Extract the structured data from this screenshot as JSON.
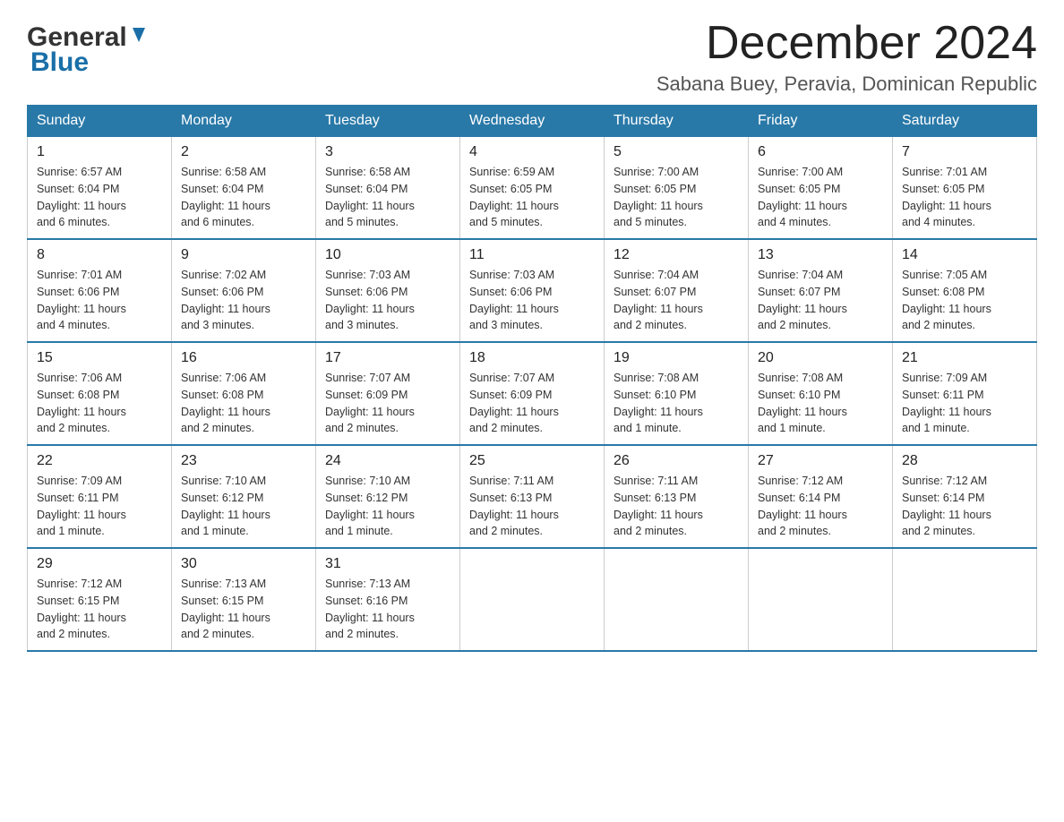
{
  "logo": {
    "general": "General",
    "blue": "Blue",
    "arrowColor": "#1a6fa8"
  },
  "header": {
    "month_year": "December 2024",
    "location": "Sabana Buey, Peravia, Dominican Republic"
  },
  "weekdays": [
    "Sunday",
    "Monday",
    "Tuesday",
    "Wednesday",
    "Thursday",
    "Friday",
    "Saturday"
  ],
  "weeks": [
    [
      {
        "day": "1",
        "sunrise": "6:57 AM",
        "sunset": "6:04 PM",
        "daylight": "11 hours and 6 minutes."
      },
      {
        "day": "2",
        "sunrise": "6:58 AM",
        "sunset": "6:04 PM",
        "daylight": "11 hours and 6 minutes."
      },
      {
        "day": "3",
        "sunrise": "6:58 AM",
        "sunset": "6:04 PM",
        "daylight": "11 hours and 5 minutes."
      },
      {
        "day": "4",
        "sunrise": "6:59 AM",
        "sunset": "6:05 PM",
        "daylight": "11 hours and 5 minutes."
      },
      {
        "day": "5",
        "sunrise": "7:00 AM",
        "sunset": "6:05 PM",
        "daylight": "11 hours and 5 minutes."
      },
      {
        "day": "6",
        "sunrise": "7:00 AM",
        "sunset": "6:05 PM",
        "daylight": "11 hours and 4 minutes."
      },
      {
        "day": "7",
        "sunrise": "7:01 AM",
        "sunset": "6:05 PM",
        "daylight": "11 hours and 4 minutes."
      }
    ],
    [
      {
        "day": "8",
        "sunrise": "7:01 AM",
        "sunset": "6:06 PM",
        "daylight": "11 hours and 4 minutes."
      },
      {
        "day": "9",
        "sunrise": "7:02 AM",
        "sunset": "6:06 PM",
        "daylight": "11 hours and 3 minutes."
      },
      {
        "day": "10",
        "sunrise": "7:03 AM",
        "sunset": "6:06 PM",
        "daylight": "11 hours and 3 minutes."
      },
      {
        "day": "11",
        "sunrise": "7:03 AM",
        "sunset": "6:06 PM",
        "daylight": "11 hours and 3 minutes."
      },
      {
        "day": "12",
        "sunrise": "7:04 AM",
        "sunset": "6:07 PM",
        "daylight": "11 hours and 2 minutes."
      },
      {
        "day": "13",
        "sunrise": "7:04 AM",
        "sunset": "6:07 PM",
        "daylight": "11 hours and 2 minutes."
      },
      {
        "day": "14",
        "sunrise": "7:05 AM",
        "sunset": "6:08 PM",
        "daylight": "11 hours and 2 minutes."
      }
    ],
    [
      {
        "day": "15",
        "sunrise": "7:06 AM",
        "sunset": "6:08 PM",
        "daylight": "11 hours and 2 minutes."
      },
      {
        "day": "16",
        "sunrise": "7:06 AM",
        "sunset": "6:08 PM",
        "daylight": "11 hours and 2 minutes."
      },
      {
        "day": "17",
        "sunrise": "7:07 AM",
        "sunset": "6:09 PM",
        "daylight": "11 hours and 2 minutes."
      },
      {
        "day": "18",
        "sunrise": "7:07 AM",
        "sunset": "6:09 PM",
        "daylight": "11 hours and 2 minutes."
      },
      {
        "day": "19",
        "sunrise": "7:08 AM",
        "sunset": "6:10 PM",
        "daylight": "11 hours and 1 minute."
      },
      {
        "day": "20",
        "sunrise": "7:08 AM",
        "sunset": "6:10 PM",
        "daylight": "11 hours and 1 minute."
      },
      {
        "day": "21",
        "sunrise": "7:09 AM",
        "sunset": "6:11 PM",
        "daylight": "11 hours and 1 minute."
      }
    ],
    [
      {
        "day": "22",
        "sunrise": "7:09 AM",
        "sunset": "6:11 PM",
        "daylight": "11 hours and 1 minute."
      },
      {
        "day": "23",
        "sunrise": "7:10 AM",
        "sunset": "6:12 PM",
        "daylight": "11 hours and 1 minute."
      },
      {
        "day": "24",
        "sunrise": "7:10 AM",
        "sunset": "6:12 PM",
        "daylight": "11 hours and 1 minute."
      },
      {
        "day": "25",
        "sunrise": "7:11 AM",
        "sunset": "6:13 PM",
        "daylight": "11 hours and 2 minutes."
      },
      {
        "day": "26",
        "sunrise": "7:11 AM",
        "sunset": "6:13 PM",
        "daylight": "11 hours and 2 minutes."
      },
      {
        "day": "27",
        "sunrise": "7:12 AM",
        "sunset": "6:14 PM",
        "daylight": "11 hours and 2 minutes."
      },
      {
        "day": "28",
        "sunrise": "7:12 AM",
        "sunset": "6:14 PM",
        "daylight": "11 hours and 2 minutes."
      }
    ],
    [
      {
        "day": "29",
        "sunrise": "7:12 AM",
        "sunset": "6:15 PM",
        "daylight": "11 hours and 2 minutes."
      },
      {
        "day": "30",
        "sunrise": "7:13 AM",
        "sunset": "6:15 PM",
        "daylight": "11 hours and 2 minutes."
      },
      {
        "day": "31",
        "sunrise": "7:13 AM",
        "sunset": "6:16 PM",
        "daylight": "11 hours and 2 minutes."
      },
      null,
      null,
      null,
      null
    ]
  ],
  "labels": {
    "sunrise": "Sunrise:",
    "sunset": "Sunset:",
    "daylight": "Daylight:"
  }
}
